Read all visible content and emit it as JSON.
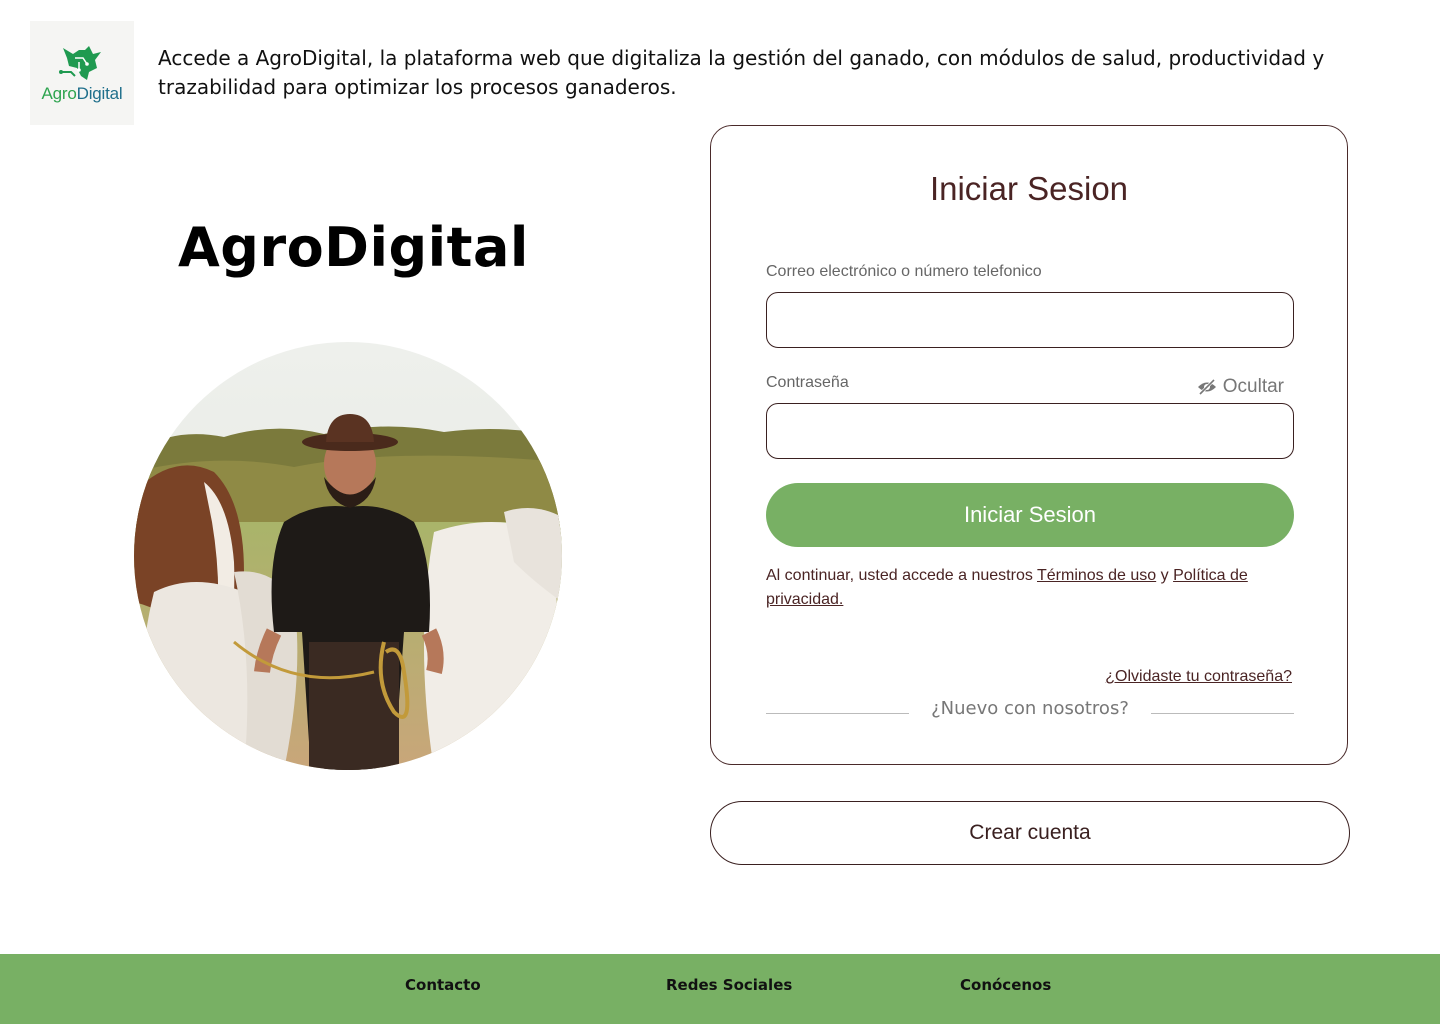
{
  "header": {
    "logo": {
      "word_a": "Agro",
      "word_b": "Digital",
      "icon": "bull-head-circuit-icon"
    },
    "tagline": "Accede a AgroDigital, la plataforma web que digitaliza la gestión del ganado, con módulos de salud, productividad y trazabilidad para optimizar los procesos ganaderos."
  },
  "hero": {
    "brand_title": "AgroDigital"
  },
  "login": {
    "title": "Iniciar Sesion",
    "email_label": "Correo electrónico o número telefonico",
    "email_value": "",
    "password_label": "Contraseña",
    "password_value": "",
    "toggle_label": "Ocultar",
    "toggle_icon": "eye-slash-icon",
    "submit_label": "Iniciar Sesion",
    "terms_prefix": "Al continuar, usted accede a nuestros ",
    "terms_link": "Términos de uso",
    "terms_middle": " y ",
    "privacy_link": "Política de privacidad.",
    "forgot_link": "¿Olvidaste tu contraseña?",
    "divider_text": "¿Nuevo con nosotros?"
  },
  "create_account_label": "Crear cuenta",
  "footer": {
    "links": [
      "Contacto",
      "Redes Sociales",
      "Conócenos"
    ]
  },
  "colors": {
    "accent_green": "#78b064",
    "brand_dark": "#4a2424",
    "logo_green": "#2ea44f",
    "logo_blue": "#1f6f8b"
  }
}
